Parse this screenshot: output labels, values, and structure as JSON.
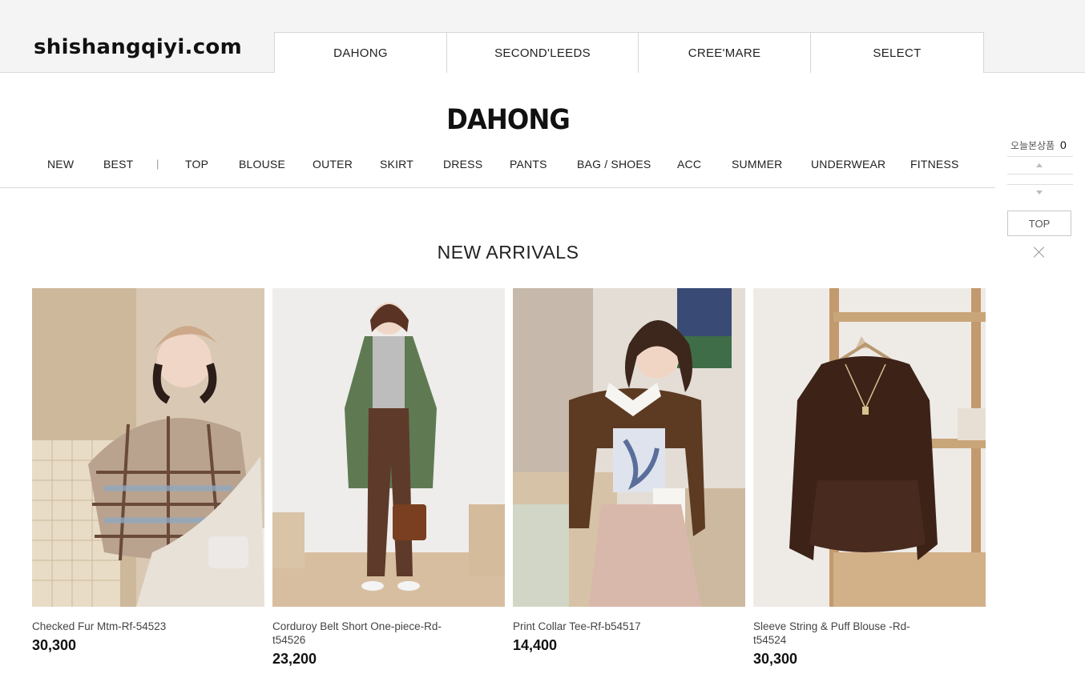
{
  "site": {
    "logo": "shishangqiyi.com"
  },
  "brand_tabs": [
    "DAHONG",
    "SECOND'LEEDS",
    "CREE'MARE",
    "SELECT"
  ],
  "brand_title": "DAHONG",
  "categories": [
    "NEW",
    "BEST",
    "TOP",
    "BLOUSE",
    "OUTER",
    "SKIRT",
    "DRESS",
    "PANTS",
    "BAG / SHOES",
    "ACC",
    "SUMMER",
    "UNDERWEAR",
    "FITNESS"
  ],
  "category_separator": "|",
  "quick_panel": {
    "recent_label": "오늘본상품",
    "recent_count": "0",
    "top_label": "TOP"
  },
  "section_title": "NEW ARRIVALS",
  "products": [
    {
      "name": "Checked Fur Mtm-Rf-54523",
      "price": "30,300"
    },
    {
      "name": "Corduroy Belt Short One-piece-Rd-t54526",
      "price": "23,200"
    },
    {
      "name": "Print Collar Tee-Rf-b54517",
      "price": "14,400"
    },
    {
      "name": "Sleeve String & Puff Blouse -Rd-t54524",
      "price": "30,300"
    }
  ]
}
